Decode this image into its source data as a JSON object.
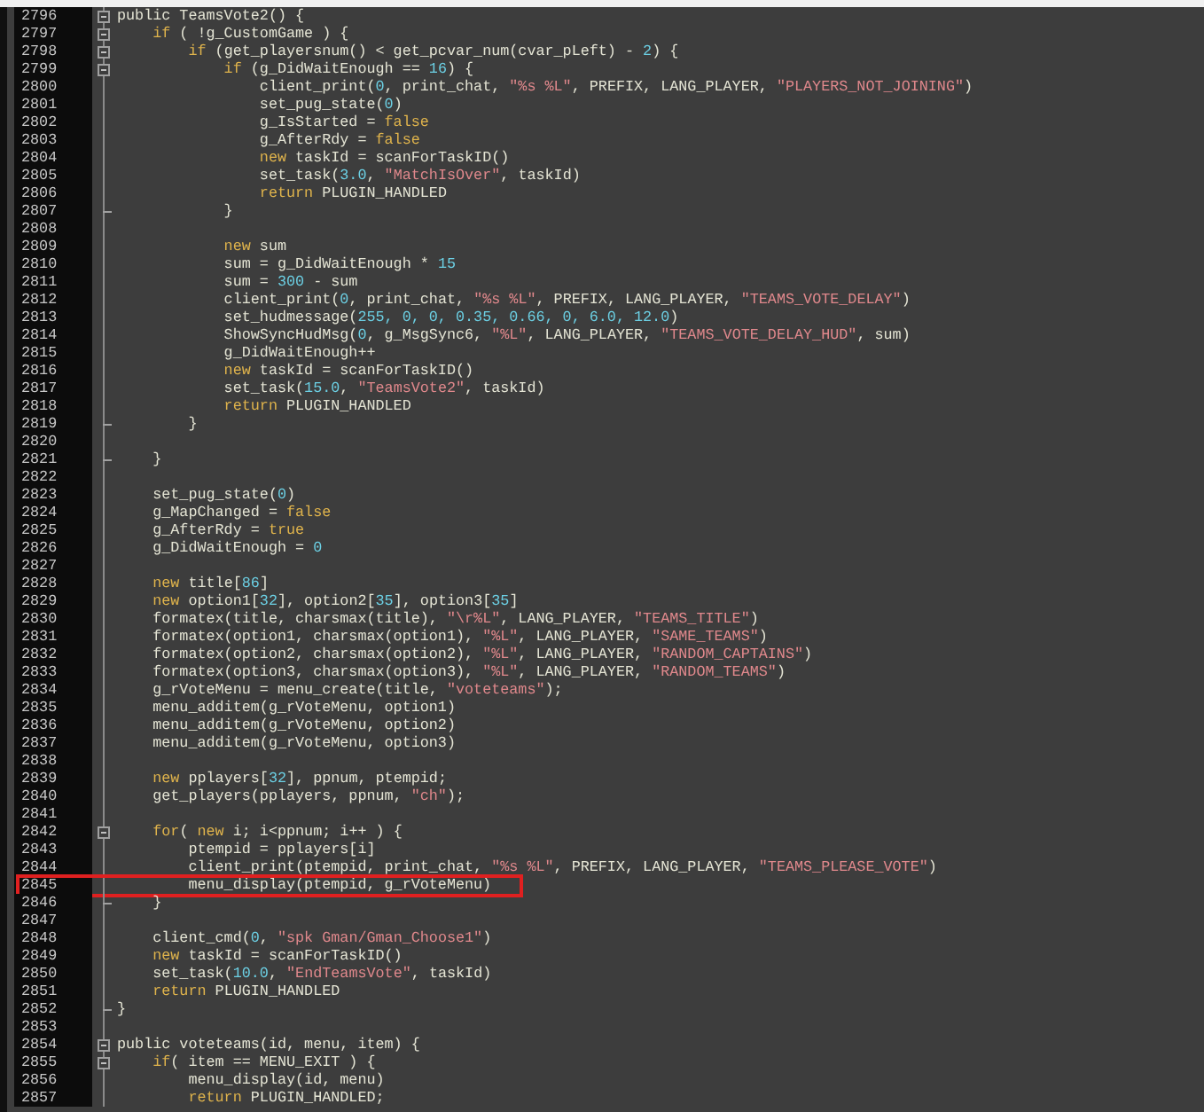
{
  "editor": {
    "lines": [
      {
        "number": "2796",
        "collapsible": true,
        "block_end": false,
        "segments": [
          {
            "kind": "plain",
            "text": "public TeamsVote2() {"
          }
        ]
      },
      {
        "number": "2797",
        "collapsible": true,
        "block_end": false,
        "segments": [
          {
            "kind": "keyword",
            "text": "    if"
          },
          {
            "kind": "plain",
            "text": " ( !g_CustomGame ) {"
          }
        ]
      },
      {
        "number": "2798",
        "collapsible": true,
        "block_end": false,
        "segments": [
          {
            "kind": "keyword",
            "text": "        if"
          },
          {
            "kind": "plain",
            "text": " (get_playersnum() < get_pcvar_num(cvar_pLeft) - "
          },
          {
            "kind": "number",
            "text": "2"
          },
          {
            "kind": "plain",
            "text": ") {"
          }
        ]
      },
      {
        "number": "2799",
        "collapsible": true,
        "block_end": false,
        "segments": [
          {
            "kind": "keyword",
            "text": "            if"
          },
          {
            "kind": "plain",
            "text": " (g_DidWaitEnough == "
          },
          {
            "kind": "number",
            "text": "16"
          },
          {
            "kind": "plain",
            "text": ") {"
          }
        ]
      },
      {
        "number": "2800",
        "collapsible": false,
        "block_end": false,
        "segments": [
          {
            "kind": "plain",
            "text": "                client_print("
          },
          {
            "kind": "number",
            "text": "0"
          },
          {
            "kind": "plain",
            "text": ", print_chat, "
          },
          {
            "kind": "string",
            "text": "\"%s %L\""
          },
          {
            "kind": "plain",
            "text": ", PREFIX, LANG_PLAYER, "
          },
          {
            "kind": "string",
            "text": "\"PLAYERS_NOT_JOINING\""
          },
          {
            "kind": "plain",
            "text": ")"
          }
        ]
      },
      {
        "number": "2801",
        "collapsible": false,
        "block_end": false,
        "segments": [
          {
            "kind": "plain",
            "text": "                set_pug_state("
          },
          {
            "kind": "number",
            "text": "0"
          },
          {
            "kind": "plain",
            "text": ")"
          }
        ]
      },
      {
        "number": "2802",
        "collapsible": false,
        "block_end": false,
        "segments": [
          {
            "kind": "plain",
            "text": "                g_IsStarted = "
          },
          {
            "kind": "keyword",
            "text": "false"
          }
        ]
      },
      {
        "number": "2803",
        "collapsible": false,
        "block_end": false,
        "segments": [
          {
            "kind": "plain",
            "text": "                g_AfterRdy = "
          },
          {
            "kind": "keyword",
            "text": "false"
          }
        ]
      },
      {
        "number": "2804",
        "collapsible": false,
        "block_end": false,
        "segments": [
          {
            "kind": "keyword",
            "text": "                new"
          },
          {
            "kind": "plain",
            "text": " taskId = scanForTaskID()"
          }
        ]
      },
      {
        "number": "2805",
        "collapsible": false,
        "block_end": false,
        "segments": [
          {
            "kind": "plain",
            "text": "                set_task("
          },
          {
            "kind": "number",
            "text": "3.0"
          },
          {
            "kind": "plain",
            "text": ", "
          },
          {
            "kind": "string",
            "text": "\"MatchIsOver\""
          },
          {
            "kind": "plain",
            "text": ", taskId)"
          }
        ]
      },
      {
        "number": "2806",
        "collapsible": false,
        "block_end": false,
        "segments": [
          {
            "kind": "keyword",
            "text": "                return"
          },
          {
            "kind": "plain",
            "text": " PLUGIN_HANDLED"
          }
        ]
      },
      {
        "number": "2807",
        "collapsible": false,
        "block_end": true,
        "segments": [
          {
            "kind": "plain",
            "text": "            }"
          }
        ]
      },
      {
        "number": "2808",
        "collapsible": false,
        "block_end": false
      },
      {
        "number": "2809",
        "collapsible": false,
        "block_end": false,
        "segments": [
          {
            "kind": "keyword",
            "text": "            new"
          },
          {
            "kind": "plain",
            "text": " sum"
          }
        ]
      },
      {
        "number": "2810",
        "collapsible": false,
        "block_end": false,
        "segments": [
          {
            "kind": "plain",
            "text": "            sum = g_DidWaitEnough * "
          },
          {
            "kind": "number",
            "text": "15"
          }
        ]
      },
      {
        "number": "2811",
        "collapsible": false,
        "block_end": false,
        "segments": [
          {
            "kind": "plain",
            "text": "            sum = "
          },
          {
            "kind": "number",
            "text": "300"
          },
          {
            "kind": "plain",
            "text": " - sum"
          }
        ]
      },
      {
        "number": "2812",
        "collapsible": false,
        "block_end": false,
        "segments": [
          {
            "kind": "plain",
            "text": "            client_print("
          },
          {
            "kind": "number",
            "text": "0"
          },
          {
            "kind": "plain",
            "text": ", print_chat, "
          },
          {
            "kind": "string",
            "text": "\"%s %L\""
          },
          {
            "kind": "plain",
            "text": ", PREFIX, LANG_PLAYER, "
          },
          {
            "kind": "string",
            "text": "\"TEAMS_VOTE_DELAY\""
          },
          {
            "kind": "plain",
            "text": ")"
          }
        ]
      },
      {
        "number": "2813",
        "collapsible": false,
        "block_end": false,
        "segments": [
          {
            "kind": "plain",
            "text": "            set_hudmessage("
          },
          {
            "kind": "number",
            "text": "255, 0, 0, 0.35, 0.66, 0, 6.0, 12.0"
          },
          {
            "kind": "plain",
            "text": ")"
          }
        ]
      },
      {
        "number": "2814",
        "collapsible": false,
        "block_end": false,
        "segments": [
          {
            "kind": "plain",
            "text": "            ShowSyncHudMsg("
          },
          {
            "kind": "number",
            "text": "0"
          },
          {
            "kind": "plain",
            "text": ", g_MsgSync6, "
          },
          {
            "kind": "string",
            "text": "\"%L\""
          },
          {
            "kind": "plain",
            "text": ", LANG_PLAYER, "
          },
          {
            "kind": "string",
            "text": "\"TEAMS_VOTE_DELAY_HUD\""
          },
          {
            "kind": "plain",
            "text": ", sum)"
          }
        ]
      },
      {
        "number": "2815",
        "collapsible": false,
        "block_end": false,
        "segments": [
          {
            "kind": "plain",
            "text": "            g_DidWaitEnough++"
          }
        ]
      },
      {
        "number": "2816",
        "collapsible": false,
        "block_end": false,
        "segments": [
          {
            "kind": "keyword",
            "text": "            new"
          },
          {
            "kind": "plain",
            "text": " taskId = scanForTaskID()"
          }
        ]
      },
      {
        "number": "2817",
        "collapsible": false,
        "block_end": false,
        "segments": [
          {
            "kind": "plain",
            "text": "            set_task("
          },
          {
            "kind": "number",
            "text": "15.0"
          },
          {
            "kind": "plain",
            "text": ", "
          },
          {
            "kind": "string",
            "text": "\"TeamsVote2\""
          },
          {
            "kind": "plain",
            "text": ", taskId)"
          }
        ]
      },
      {
        "number": "2818",
        "collapsible": false,
        "block_end": false,
        "segments": [
          {
            "kind": "keyword",
            "text": "            return"
          },
          {
            "kind": "plain",
            "text": " PLUGIN_HANDLED"
          }
        ]
      },
      {
        "number": "2819",
        "collapsible": false,
        "block_end": true,
        "segments": [
          {
            "kind": "plain",
            "text": "        }"
          }
        ]
      },
      {
        "number": "2820",
        "collapsible": false,
        "block_end": false
      },
      {
        "number": "2821",
        "collapsible": false,
        "block_end": true,
        "segments": [
          {
            "kind": "plain",
            "text": "    }"
          }
        ]
      },
      {
        "number": "2822",
        "collapsible": false,
        "block_end": false
      },
      {
        "number": "2823",
        "collapsible": false,
        "block_end": false,
        "segments": [
          {
            "kind": "plain",
            "text": "    set_pug_state("
          },
          {
            "kind": "number",
            "text": "0"
          },
          {
            "kind": "plain",
            "text": ")"
          }
        ]
      },
      {
        "number": "2824",
        "collapsible": false,
        "block_end": false,
        "segments": [
          {
            "kind": "plain",
            "text": "    g_MapChanged = "
          },
          {
            "kind": "keyword",
            "text": "false"
          }
        ]
      },
      {
        "number": "2825",
        "collapsible": false,
        "block_end": false,
        "segments": [
          {
            "kind": "plain",
            "text": "    g_AfterRdy = "
          },
          {
            "kind": "keyword",
            "text": "true"
          }
        ]
      },
      {
        "number": "2826",
        "collapsible": false,
        "block_end": false,
        "segments": [
          {
            "kind": "plain",
            "text": "    g_DidWaitEnough = "
          },
          {
            "kind": "number",
            "text": "0"
          }
        ]
      },
      {
        "number": "2827",
        "collapsible": false,
        "block_end": false
      },
      {
        "number": "2828",
        "collapsible": false,
        "block_end": false,
        "segments": [
          {
            "kind": "keyword",
            "text": "    new"
          },
          {
            "kind": "plain",
            "text": " title["
          },
          {
            "kind": "number",
            "text": "86"
          },
          {
            "kind": "plain",
            "text": "]"
          }
        ]
      },
      {
        "number": "2829",
        "collapsible": false,
        "block_end": false,
        "segments": [
          {
            "kind": "keyword",
            "text": "    new"
          },
          {
            "kind": "plain",
            "text": " option1["
          },
          {
            "kind": "number",
            "text": "32"
          },
          {
            "kind": "plain",
            "text": "], option2["
          },
          {
            "kind": "number",
            "text": "35"
          },
          {
            "kind": "plain",
            "text": "], option3["
          },
          {
            "kind": "number",
            "text": "35"
          },
          {
            "kind": "plain",
            "text": "]"
          }
        ]
      },
      {
        "number": "2830",
        "collapsible": false,
        "block_end": false,
        "segments": [
          {
            "kind": "plain",
            "text": "    formatex(title, charsmax(title), "
          },
          {
            "kind": "string",
            "text": "\"\\r%L\""
          },
          {
            "kind": "plain",
            "text": ", LANG_PLAYER, "
          },
          {
            "kind": "string",
            "text": "\"TEAMS_TITLE\""
          },
          {
            "kind": "plain",
            "text": ")"
          }
        ]
      },
      {
        "number": "2831",
        "collapsible": false,
        "block_end": false,
        "segments": [
          {
            "kind": "plain",
            "text": "    formatex(option1, charsmax(option1), "
          },
          {
            "kind": "string",
            "text": "\"%L\""
          },
          {
            "kind": "plain",
            "text": ", LANG_PLAYER, "
          },
          {
            "kind": "string",
            "text": "\"SAME_TEAMS\""
          },
          {
            "kind": "plain",
            "text": ")"
          }
        ]
      },
      {
        "number": "2832",
        "collapsible": false,
        "block_end": false,
        "segments": [
          {
            "kind": "plain",
            "text": "    formatex(option2, charsmax(option2), "
          },
          {
            "kind": "string",
            "text": "\"%L\""
          },
          {
            "kind": "plain",
            "text": ", LANG_PLAYER, "
          },
          {
            "kind": "string",
            "text": "\"RANDOM_CAPTAINS\""
          },
          {
            "kind": "plain",
            "text": ")"
          }
        ]
      },
      {
        "number": "2833",
        "collapsible": false,
        "block_end": false,
        "segments": [
          {
            "kind": "plain",
            "text": "    formatex(option3, charsmax(option3), "
          },
          {
            "kind": "string",
            "text": "\"%L\""
          },
          {
            "kind": "plain",
            "text": ", LANG_PLAYER, "
          },
          {
            "kind": "string",
            "text": "\"RANDOM_TEAMS\""
          },
          {
            "kind": "plain",
            "text": ")"
          }
        ]
      },
      {
        "number": "2834",
        "collapsible": false,
        "block_end": false,
        "segments": [
          {
            "kind": "plain",
            "text": "    g_rVoteMenu = menu_create(title, "
          },
          {
            "kind": "string",
            "text": "\"voteteams\""
          },
          {
            "kind": "plain",
            "text": ");"
          }
        ]
      },
      {
        "number": "2835",
        "collapsible": false,
        "block_end": false,
        "segments": [
          {
            "kind": "plain",
            "text": "    menu_additem(g_rVoteMenu, option1)"
          }
        ]
      },
      {
        "number": "2836",
        "collapsible": false,
        "block_end": false,
        "segments": [
          {
            "kind": "plain",
            "text": "    menu_additem(g_rVoteMenu, option2)"
          }
        ]
      },
      {
        "number": "2837",
        "collapsible": false,
        "block_end": false,
        "segments": [
          {
            "kind": "plain",
            "text": "    menu_additem(g_rVoteMenu, option3)"
          }
        ]
      },
      {
        "number": "2838",
        "collapsible": false,
        "block_end": false
      },
      {
        "number": "2839",
        "collapsible": false,
        "block_end": false,
        "segments": [
          {
            "kind": "keyword",
            "text": "    new"
          },
          {
            "kind": "plain",
            "text": " pplayers["
          },
          {
            "kind": "number",
            "text": "32"
          },
          {
            "kind": "plain",
            "text": "], ppnum, ptempid;"
          }
        ]
      },
      {
        "number": "2840",
        "collapsible": false,
        "block_end": false,
        "segments": [
          {
            "kind": "plain",
            "text": "    get_players(pplayers, ppnum, "
          },
          {
            "kind": "string",
            "text": "\"ch\""
          },
          {
            "kind": "plain",
            "text": ");"
          }
        ]
      },
      {
        "number": "2841",
        "collapsible": false,
        "block_end": false
      },
      {
        "number": "2842",
        "collapsible": true,
        "block_end": false,
        "segments": [
          {
            "kind": "keyword",
            "text": "    for"
          },
          {
            "kind": "plain",
            "text": "( "
          },
          {
            "kind": "keyword",
            "text": "new"
          },
          {
            "kind": "plain",
            "text": " i; i<ppnum; i++ ) {"
          }
        ]
      },
      {
        "number": "2843",
        "collapsible": false,
        "block_end": false,
        "segments": [
          {
            "kind": "plain",
            "text": "        ptempid = pplayers[i]"
          }
        ]
      },
      {
        "number": "2844",
        "collapsible": false,
        "block_end": false,
        "segments": [
          {
            "kind": "plain",
            "text": "        client_print(ptempid, print_chat, "
          },
          {
            "kind": "string",
            "text": "\"%s %L\""
          },
          {
            "kind": "plain",
            "text": ", PREFIX, LANG_PLAYER, "
          },
          {
            "kind": "string",
            "text": "\"TEAMS_PLEASE_VOTE\""
          },
          {
            "kind": "plain",
            "text": ")"
          }
        ]
      },
      {
        "number": "2845",
        "collapsible": false,
        "block_end": false,
        "highlighted": true,
        "segments": [
          {
            "kind": "plain",
            "text": "        menu_display(ptempid, g_rVoteMenu)"
          }
        ]
      },
      {
        "number": "2846",
        "collapsible": false,
        "block_end": true,
        "segments": [
          {
            "kind": "plain",
            "text": "    }"
          }
        ]
      },
      {
        "number": "2847",
        "collapsible": false,
        "block_end": false
      },
      {
        "number": "2848",
        "collapsible": false,
        "block_end": false,
        "segments": [
          {
            "kind": "plain",
            "text": "    client_cmd("
          },
          {
            "kind": "number",
            "text": "0"
          },
          {
            "kind": "plain",
            "text": ", "
          },
          {
            "kind": "string",
            "text": "\"spk Gman/Gman_Choose1\""
          },
          {
            "kind": "plain",
            "text": ")"
          }
        ]
      },
      {
        "number": "2849",
        "collapsible": false,
        "block_end": false,
        "segments": [
          {
            "kind": "keyword",
            "text": "    new"
          },
          {
            "kind": "plain",
            "text": " taskId = scanForTaskID()"
          }
        ]
      },
      {
        "number": "2850",
        "collapsible": false,
        "block_end": false,
        "segments": [
          {
            "kind": "plain",
            "text": "    set_task("
          },
          {
            "kind": "number",
            "text": "10.0"
          },
          {
            "kind": "plain",
            "text": ", "
          },
          {
            "kind": "string",
            "text": "\"EndTeamsVote\""
          },
          {
            "kind": "plain",
            "text": ", taskId)"
          }
        ]
      },
      {
        "number": "2851",
        "collapsible": false,
        "block_end": false,
        "segments": [
          {
            "kind": "keyword",
            "text": "    return"
          },
          {
            "kind": "plain",
            "text": " PLUGIN_HANDLED"
          }
        ]
      },
      {
        "number": "2852",
        "collapsible": false,
        "block_end": true,
        "segments": [
          {
            "kind": "plain",
            "text": "}"
          }
        ]
      },
      {
        "number": "2853",
        "collapsible": false,
        "block_end": false
      },
      {
        "number": "2854",
        "collapsible": true,
        "block_end": false,
        "segments": [
          {
            "kind": "plain",
            "text": "public voteteams(id, menu, item) {"
          }
        ]
      },
      {
        "number": "2855",
        "collapsible": true,
        "block_end": false,
        "segments": [
          {
            "kind": "keyword",
            "text": "    if"
          },
          {
            "kind": "plain",
            "text": "( item == MENU_EXIT ) {"
          }
        ]
      },
      {
        "number": "2856",
        "collapsible": false,
        "block_end": false,
        "segments": [
          {
            "kind": "plain",
            "text": "        menu_display(id, menu)"
          }
        ]
      },
      {
        "number": "2857",
        "collapsible": false,
        "block_end": false,
        "segments": [
          {
            "kind": "keyword",
            "text": "        return"
          },
          {
            "kind": "plain",
            "text": " PLUGIN_HANDLED;"
          }
        ]
      }
    ]
  }
}
